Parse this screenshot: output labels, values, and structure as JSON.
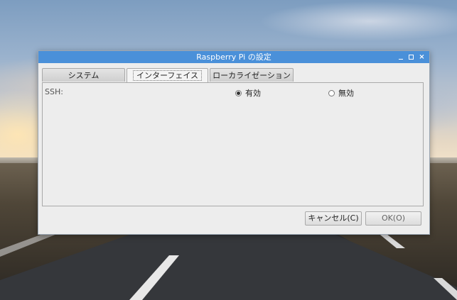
{
  "window": {
    "title": "Raspberry Pi の設定",
    "controls": {
      "minimize": "_",
      "maximize": "□",
      "close": "×"
    }
  },
  "tabs": [
    {
      "label": "システム",
      "active": false
    },
    {
      "label": "インターフェイス",
      "active": true
    },
    {
      "label": "ローカライゼーション",
      "active": false
    }
  ],
  "interface": {
    "ssh_label": "SSH:",
    "options": [
      {
        "label": "有効",
        "selected": true
      },
      {
        "label": "無効",
        "selected": false
      }
    ]
  },
  "buttons": {
    "cancel": "キャンセル(C)",
    "ok": "OK(O)"
  },
  "colors": {
    "titlebar": "#4a90d9"
  }
}
